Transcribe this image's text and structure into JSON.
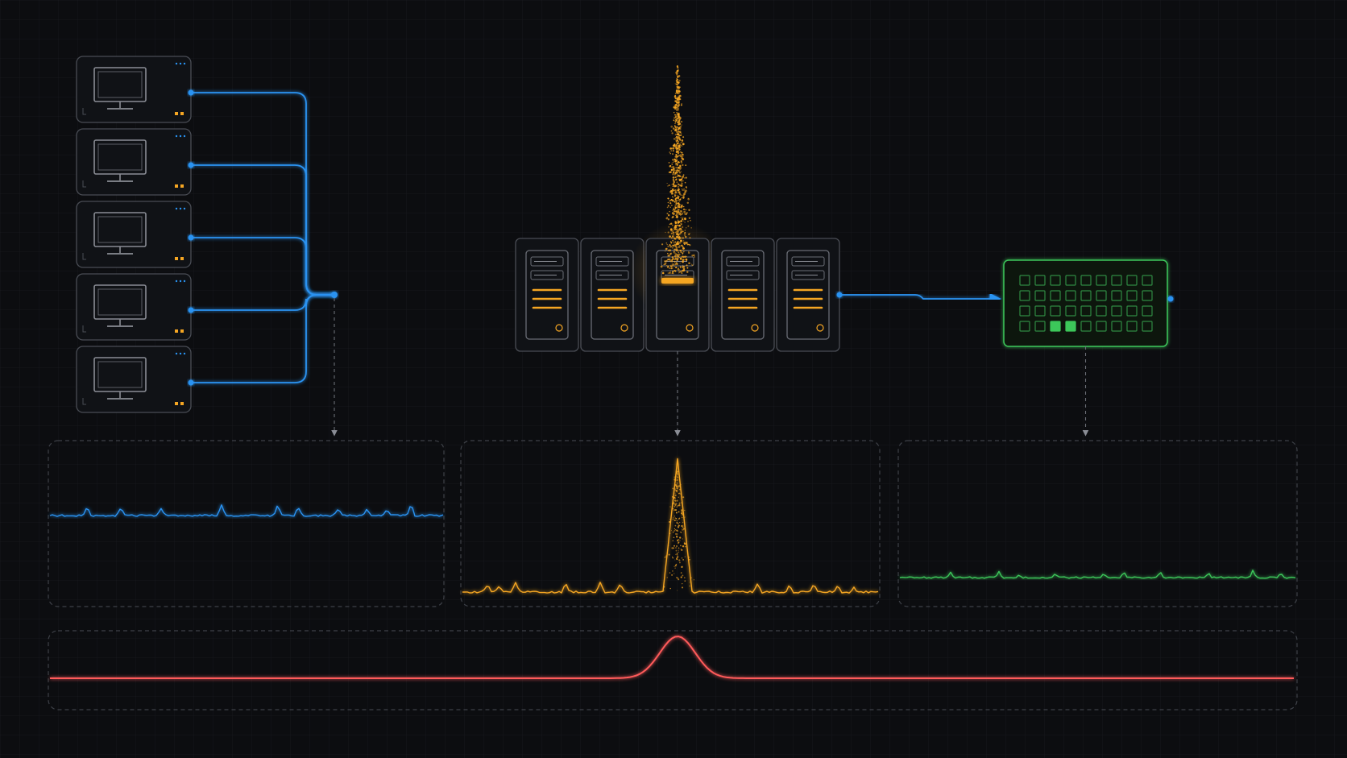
{
  "colors": {
    "background": "#0c0d10",
    "grid": "#1a1c21",
    "frame": "#4a4d55",
    "frame_dashed": "#3e4148",
    "client_link": "#2a93f2",
    "server_load": "#f5a623",
    "cache_active": "#3cc75a",
    "cache_idle": "#2f8a43",
    "latency": "#ff5a5a",
    "connector_dashed": "#6a6d75"
  },
  "icons": {
    "client": "monitor-icon",
    "server": "server-rack-icon",
    "cache": "cache-grid-icon",
    "arrow": "arrow-right-icon",
    "dashed_link": "arrow-down-icon"
  },
  "diagram": {
    "clients": [
      {
        "status": "idle"
      },
      {
        "status": "idle"
      },
      {
        "status": "idle"
      },
      {
        "status": "idle"
      },
      {
        "status": "idle"
      }
    ],
    "servers": [
      {
        "load": "normal"
      },
      {
        "load": "normal"
      },
      {
        "load": "hot"
      },
      {
        "load": "normal"
      },
      {
        "load": "normal"
      }
    ],
    "cache": {
      "rows": 4,
      "cols": 9,
      "active_cells": [
        [
          3,
          2
        ],
        [
          3,
          3
        ]
      ]
    },
    "panels": [
      {
        "id": "client-traffic",
        "series": "client_link",
        "peak": "none"
      },
      {
        "id": "server-load",
        "series": "server_load",
        "peak": "sharp"
      },
      {
        "id": "cache-activity",
        "series": "cache_active",
        "peak": "none"
      },
      {
        "id": "latency",
        "series": "latency",
        "peak": "smooth"
      }
    ]
  }
}
